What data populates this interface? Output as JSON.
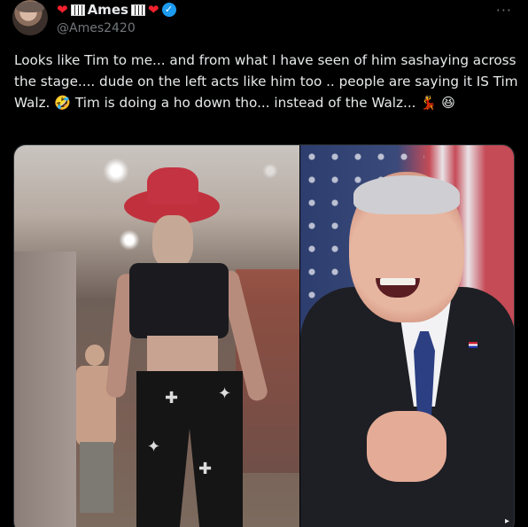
{
  "user": {
    "display_name": "Ames",
    "handle": "@Ames2420",
    "verified_icon": "verified-badge-icon",
    "name_decor_left": [
      "red-heart-emoji",
      "piano-keys-emoji"
    ],
    "name_decor_right": [
      "piano-keys-emoji",
      "red-heart-emoji"
    ]
  },
  "more_icon": "more-options-icon",
  "tweet": {
    "text": "Looks like Tim to me... and from what I have seen of him sashaying across the stage....   dude on the left acts like him too .. people are saying it IS Tim Walz.   🤣   Tim is doing a ho down tho... instead of the Walz... 💃 😆"
  },
  "colors": {
    "background": "#000000",
    "text": "#e7e9ea",
    "secondary": "#71767b",
    "verified": "#1d9bf0",
    "heart": "#f4212e"
  }
}
